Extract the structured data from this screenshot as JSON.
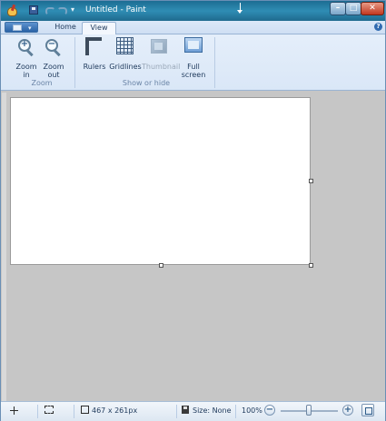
{
  "window": {
    "title": "Untitled - Paint",
    "quick_access": [
      "paint-app-icon",
      "save-icon",
      "undo-icon",
      "redo-icon",
      "customize-icon"
    ],
    "controls": [
      "minimize",
      "maximize",
      "close"
    ],
    "customize_glyph": "▾"
  },
  "ribbon": {
    "tabs": [
      {
        "label": "Home",
        "selected": false
      },
      {
        "label": "View",
        "selected": true
      }
    ],
    "app_menu_caret": "▾",
    "help_glyph": "?",
    "groups": {
      "zoom": {
        "label": "Zoom",
        "zoom_in": {
          "line1": "Zoom",
          "line2": "in",
          "icon": "zoom-in-icon",
          "sym": "+"
        },
        "zoom_out": {
          "line1": "Zoom",
          "line2": "out",
          "icon": "zoom-out-icon",
          "sym": "−"
        }
      },
      "show_hide": {
        "label": "Show or hide",
        "rulers": {
          "label": "Rulers",
          "icon": "ruler-icon"
        },
        "gridlines": {
          "label": "Gridlines",
          "icon": "gridlines-icon"
        },
        "thumbnail": {
          "label": "Thumbnail",
          "icon": "thumbnail-icon",
          "enabled": false
        }
      },
      "display": {
        "full_screen": {
          "line1": "Full",
          "line2": "screen",
          "icon": "full-screen-icon"
        }
      }
    }
  },
  "status": {
    "dimensions": "467 x 261px",
    "size": "Size: None",
    "zoom": "100%",
    "zoom_out_glyph": "−",
    "zoom_in_glyph": "+"
  },
  "colors": {
    "title_bar": "#2f8db4",
    "ribbon": "#dae7f7",
    "workspace": "#c6c6c6",
    "canvas": "#ffffff"
  }
}
